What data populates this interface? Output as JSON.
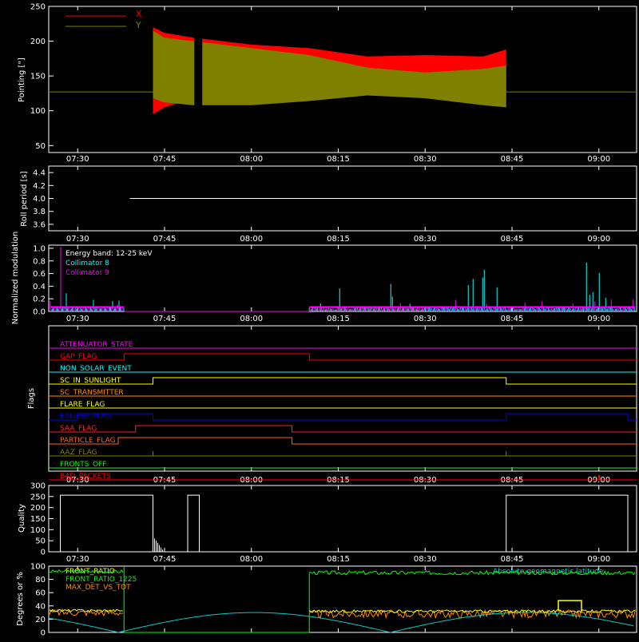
{
  "colors": {
    "background": "#000000",
    "axes": "#ffffff",
    "x_pointing": "#ff0000",
    "y_pointing": "#808000",
    "roll": "#ffffff",
    "collimator8": "#00ffff",
    "collimator9": "#ff00ff",
    "quality": "#ffffff",
    "front_ratio": "#ffff00",
    "front_ratio_1225": "#00ff00",
    "max_det_vs_tot": "#ff8c00",
    "geomag": "#00cccc"
  },
  "time_ticks": [
    "07:30",
    "07:45",
    "08:00",
    "08:15",
    "08:30",
    "08:45",
    "09:00"
  ],
  "chart_data": [
    {
      "type": "line",
      "panel": "pointing",
      "ylabel": "Pointing [\"]",
      "ylim": [
        40,
        250
      ],
      "yticks": [
        "50",
        "100",
        "150",
        "200",
        "250"
      ],
      "legend": [
        "X",
        "Y"
      ],
      "series": [
        {
          "name": "X",
          "envelope_times": [
            "07:43",
            "07:45",
            "07:50",
            "08:00",
            "08:10",
            "08:20",
            "08:30",
            "08:40",
            "08:44"
          ],
          "upper": [
            220,
            212,
            205,
            195,
            190,
            178,
            180,
            178,
            188
          ],
          "lower": [
            95,
            105,
            118,
            122,
            125,
            122,
            120,
            120,
            120
          ]
        },
        {
          "name": "Y",
          "envelope_times": [
            "07:43",
            "07:45",
            "07:50",
            "08:00",
            "08:10",
            "08:20",
            "08:30",
            "08:40",
            "08:44"
          ],
          "upper": [
            215,
            205,
            200,
            190,
            180,
            162,
            155,
            160,
            165
          ],
          "lower": [
            118,
            112,
            108,
            108,
            114,
            122,
            118,
            108,
            105
          ]
        },
        {
          "name": "baseline",
          "value": 127
        }
      ]
    },
    {
      "type": "line",
      "panel": "roll",
      "ylabel": "Roll period [s]",
      "ylim": [
        3.5,
        4.5
      ],
      "yticks": [
        "3.6",
        "3.8",
        "4.0",
        "4.2",
        "4.4"
      ],
      "series": [
        {
          "name": "Roll period",
          "value": 4.0
        }
      ]
    },
    {
      "type": "line",
      "panel": "modulation",
      "ylabel": "Normalized modulation",
      "ylim": [
        0,
        1.05
      ],
      "yticks": [
        "0.0",
        "0.2",
        "0.4",
        "0.6",
        "0.8",
        "1.0"
      ],
      "annotation": "Energy band: 12-25 keV",
      "series": [
        {
          "name": "Collimator 8"
        },
        {
          "name": "Collimator 9"
        }
      ],
      "gaps": [
        [
          "07:38",
          "08:10"
        ]
      ]
    },
    {
      "type": "line",
      "panel": "flags",
      "ylabel": "Flags",
      "series": [
        {
          "name": "ATTENUATOR_STATE",
          "steps": []
        },
        {
          "name": "GAP_FLAG",
          "steps": [
            [
              "07:38",
              "08:10"
            ]
          ]
        },
        {
          "name": "NON_SOLAR_EVENT",
          "steps": []
        },
        {
          "name": "SC_IN_SUNLIGHT",
          "steps": [
            [
              "07:43",
              "08:44"
            ]
          ]
        },
        {
          "name": "SC_TRANSMITTER",
          "steps": []
        },
        {
          "name": "FLARE_FLAG",
          "steps": []
        },
        {
          "name": "ECLIPSE_FLAG",
          "steps": [
            [
              "07:30",
              "07:43"
            ],
            [
              "08:44",
              "09:05"
            ]
          ]
        },
        {
          "name": "SAA_FLAG",
          "steps": [
            [
              "07:40",
              "08:07"
            ]
          ]
        },
        {
          "name": "PARTICLE_FLAG",
          "steps": [
            [
              "07:37",
              "08:07"
            ]
          ]
        },
        {
          "name": "AAZ_FLAG",
          "steps": []
        },
        {
          "name": "FRONTS_OFF",
          "steps": []
        },
        {
          "name": "BAD_PACKETS",
          "steps": []
        }
      ]
    },
    {
      "type": "line",
      "panel": "quality",
      "ylabel": "Quality",
      "ylim": [
        0,
        300
      ],
      "yticks": [
        "0",
        "50",
        "100",
        "150",
        "200",
        "250",
        "300"
      ],
      "series": [
        {
          "name": "Quality",
          "segments": [
            [
              "07:27",
              "07:43",
              256
            ],
            [
              "07:49",
              "07:51",
              256
            ],
            [
              "08:44",
              "09:05",
              256
            ]
          ]
        }
      ]
    },
    {
      "type": "line",
      "panel": "ratios",
      "ylabel": "Degrees or %",
      "ylim": [
        0,
        100
      ],
      "yticks": [
        "0",
        "20",
        "40",
        "60",
        "80",
        "100"
      ],
      "series": [
        {
          "name": "FRONT_RATIO",
          "approx": 30
        },
        {
          "name": "FRONT_RATIO_1225",
          "approx": 90
        },
        {
          "name": "MAX_DET_VS_TOT",
          "approx": 28
        },
        {
          "name": "Absolute geomagnetic latitude"
        }
      ]
    }
  ]
}
